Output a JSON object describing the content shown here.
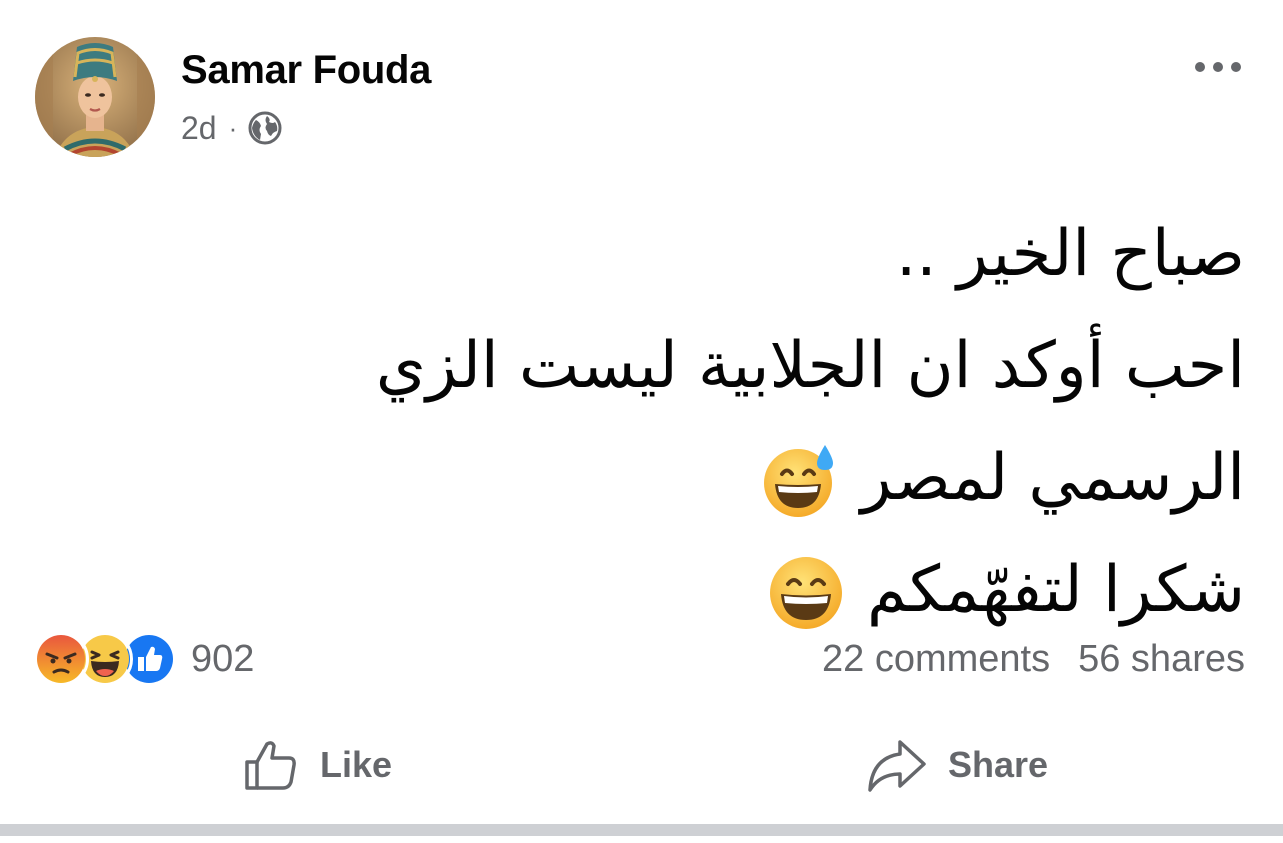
{
  "post": {
    "author": "Samar Fouda",
    "time": "2d",
    "separator": "·",
    "privacy_icon": "globe-icon",
    "lines": [
      "صباح الخير ..",
      "احب أوكد ان الجلابية ليست الزي",
      "الرسمي لمصر",
      "شكرا لتفهّمكم"
    ],
    "emojis": [
      "grinning-sweat-emoji",
      "grinning-smile-emoji"
    ]
  },
  "stats": {
    "reactions": [
      "angry-reaction",
      "haha-reaction",
      "like-reaction"
    ],
    "reaction_count": "902",
    "comments": "22 comments",
    "shares": "56 shares"
  },
  "actions": {
    "like_label": "Like",
    "share_label": "Share"
  },
  "colors": {
    "secondary_text": "#65676b",
    "like_blue": "#1877f2",
    "angry_red": "#e9573e",
    "emoji_yellow": "#f7b928"
  }
}
